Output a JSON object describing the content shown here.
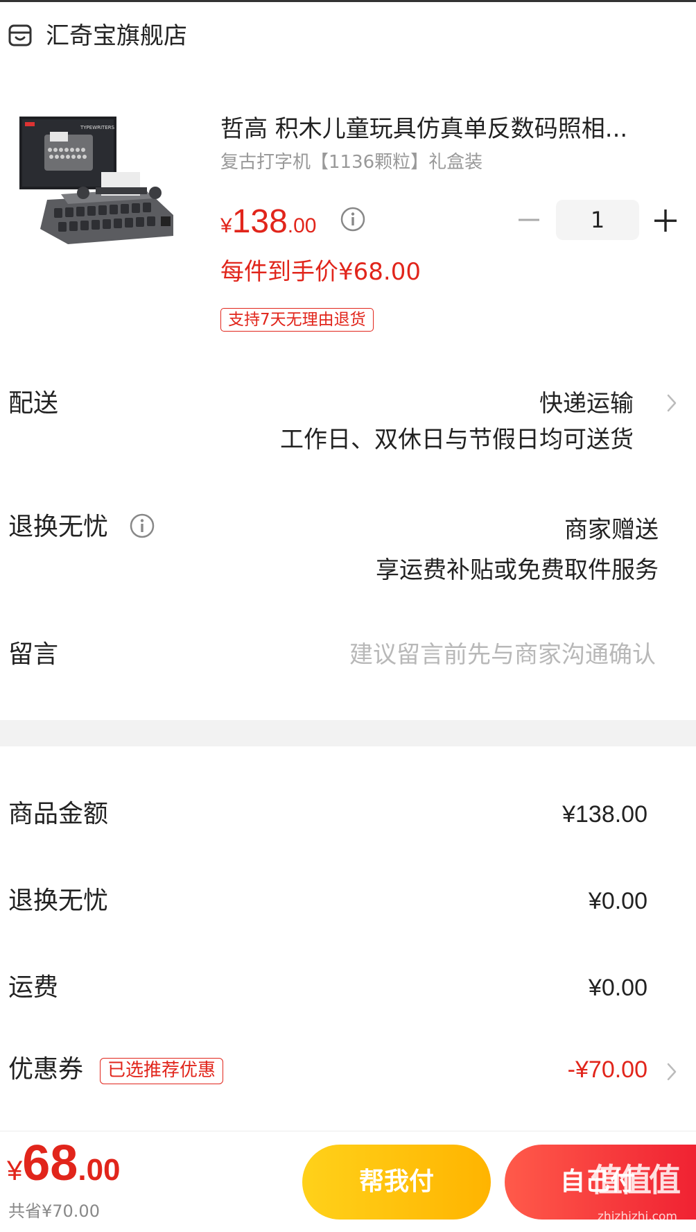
{
  "store": {
    "name": "汇奇宝旗舰店",
    "icon": "store-icon"
  },
  "product": {
    "title": "哲高 积木儿童玩具仿真单反数码照相...",
    "spec": "复古打字机【1136颗粒】礼盒装",
    "price": {
      "symbol": "¥",
      "integer": "138",
      "decimal": ".00"
    },
    "quantity": "1",
    "unit_price_text": "每件到手价¥68.00",
    "tag": "支持7天无理由退货",
    "image_label": "TYPEWRITERS"
  },
  "delivery": {
    "label": "配送",
    "method": "快递运输",
    "note": "工作日、双休日与节假日均可送货"
  },
  "return_service": {
    "label": "退换无忧",
    "value": "商家赠送",
    "note": "享运费补贴或免费取件服务"
  },
  "message": {
    "label": "留言",
    "placeholder": "建议留言前先与商家沟通确认"
  },
  "summary": {
    "goods_label": "商品金额",
    "goods_value": "¥138.00",
    "return_label": "退换无忧",
    "return_value": "¥0.00",
    "shipping_label": "运费",
    "shipping_value": "¥0.00",
    "coupon_label": "优惠券",
    "coupon_tag": "已选推荐优惠",
    "coupon_value": "-¥70.00"
  },
  "footer": {
    "total": {
      "symbol": "¥",
      "integer": "68",
      "decimal": ".00"
    },
    "saved": "共省¥70.00",
    "help_pay": "帮我付",
    "self_pay": "自己付",
    "watermark": "值值值",
    "watermark_sub": "zhizhizhi.com"
  },
  "colors": {
    "accent": "#e1251b",
    "help_button": "#ffc000",
    "pay_button": "#f02232"
  }
}
